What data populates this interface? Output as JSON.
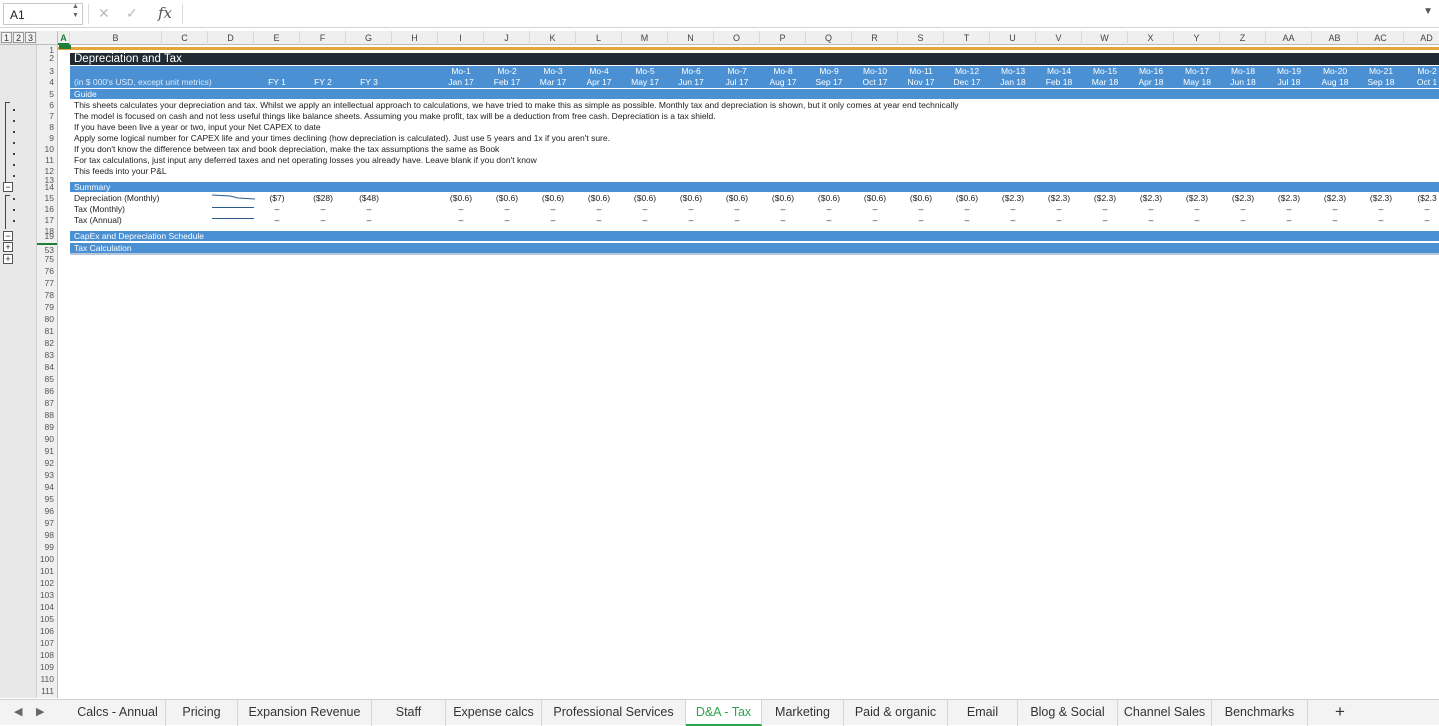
{
  "formula_bar": {
    "name_box": "A1",
    "fx": "fx",
    "formula": ""
  },
  "outline_levels": [
    "1",
    "2",
    "3"
  ],
  "columns": [
    "A",
    "B",
    "C",
    "D",
    "E",
    "F",
    "G",
    "H",
    "I",
    "J",
    "K",
    "L",
    "M",
    "N",
    "O",
    "P",
    "Q",
    "R",
    "S",
    "T",
    "U",
    "V",
    "W",
    "X",
    "Y",
    "Z",
    "AA",
    "AB",
    "AC",
    "AD"
  ],
  "rows": {
    "top": [
      "1",
      "2",
      "3",
      "4",
      "5",
      "6",
      "7",
      "8",
      "9",
      "10",
      "11",
      "12",
      "13",
      "14",
      "15",
      "16",
      "17",
      "18",
      "19",
      "53"
    ],
    "bottom": [
      "75",
      "76",
      "77",
      "78",
      "79",
      "80",
      "81",
      "82",
      "83",
      "84",
      "85",
      "86",
      "87",
      "88",
      "89",
      "90",
      "91",
      "92",
      "93",
      "94",
      "95",
      "96",
      "97",
      "98",
      "99",
      "100",
      "101",
      "102",
      "103",
      "104",
      "105",
      "106",
      "107",
      "108",
      "109",
      "110",
      "111"
    ]
  },
  "sheet": {
    "title": "Depreciation and Tax",
    "units_label": "(in $ 000's USD, except unit metrics)",
    "fy_labels": [
      "FY 1",
      "FY 2",
      "FY 3"
    ],
    "months": [
      "Mo-1",
      "Mo-2",
      "Mo-3",
      "Mo-4",
      "Mo-5",
      "Mo-6",
      "Mo-7",
      "Mo-8",
      "Mo-9",
      "Mo-10",
      "Mo-11",
      "Mo-12",
      "Mo-13",
      "Mo-14",
      "Mo-15",
      "Mo-16",
      "Mo-17",
      "Mo-18",
      "Mo-19",
      "Mo-20",
      "Mo-21",
      "Mo-2"
    ],
    "dates": [
      "Jan 17",
      "Feb 17",
      "Mar 17",
      "Apr 17",
      "May 17",
      "Jun 17",
      "Jul 17",
      "Aug 17",
      "Sep 17",
      "Oct 17",
      "Nov 17",
      "Dec 17",
      "Jan 18",
      "Feb 18",
      "Mar 18",
      "Apr 18",
      "May 18",
      "Jun 18",
      "Jul 18",
      "Aug 18",
      "Sep 18",
      "Oct 1"
    ],
    "guide_header": "Guide",
    "guide_lines": [
      "This sheets calculates your depreciation and tax. Whilst we apply an intellectual approach to calculations, we have tried to make this as simple as possible. Monthly tax and depreciation is shown, but it only comes at year end technically",
      "The model is focused on cash and not less useful things like balance sheets. Assuming you make profit, tax will be a deduction from free cash. Depreciation is a tax shield.",
      "If you have been live a year or two, input your Net CAPEX to date",
      "Apply some logical number for CAPEX life and your times declining (how depreciation is calculated). Just use 5 years and 1x if you aren't sure.",
      "If you don't know the difference between tax and book depreciation, make the tax assumptions the same as Book",
      "For tax calculations, just input any deferred taxes and net operating losses you already have. Leave blank if you don't know",
      "This feeds into your P&L"
    ],
    "summary_header": "Summary",
    "summary_rows": [
      {
        "label": "Depreciation (Monthly)",
        "fy": [
          "($7)",
          "($28)",
          "($48)"
        ],
        "monthly": [
          "($0.6)",
          "($0.6)",
          "($0.6)",
          "($0.6)",
          "($0.6)",
          "($0.6)",
          "($0.6)",
          "($0.6)",
          "($0.6)",
          "($0.6)",
          "($0.6)",
          "($0.6)",
          "($2.3)",
          "($2.3)",
          "($2.3)",
          "($2.3)",
          "($2.3)",
          "($2.3)",
          "($2.3)",
          "($2.3)",
          "($2.3)",
          "($2.3"
        ]
      },
      {
        "label": "Tax (Monthly)",
        "fy": [
          "–",
          "–",
          "–"
        ],
        "monthly": [
          "–",
          "–",
          "–",
          "–",
          "–",
          "–",
          "–",
          "–",
          "–",
          "–",
          "–",
          "–",
          "–",
          "–",
          "–",
          "–",
          "–",
          "–",
          "–",
          "–",
          "–",
          "–"
        ]
      },
      {
        "label": "Tax (Annual)",
        "fy": [
          "–",
          "–",
          "–"
        ],
        "monthly": [
          "–",
          "–",
          "–",
          "–",
          "–",
          "–",
          "–",
          "–",
          "–",
          "–",
          "–",
          "–",
          "–",
          "–",
          "–",
          "–",
          "–",
          "–",
          "–",
          "–",
          "–",
          "–"
        ]
      }
    ],
    "capex_header": "CapEx and Depreciation Schedule",
    "tax_header": "Tax Calculation"
  },
  "tabs": [
    {
      "label": "Calcs - Annual"
    },
    {
      "label": "Pricing"
    },
    {
      "label": "Expansion Revenue"
    },
    {
      "label": "Staff"
    },
    {
      "label": "Expense calcs"
    },
    {
      "label": "Professional Services"
    },
    {
      "label": "D&A - Tax",
      "active": true
    },
    {
      "label": "Marketing"
    },
    {
      "label": "Paid & organic"
    },
    {
      "label": "Email"
    },
    {
      "label": "Blog & Social"
    },
    {
      "label": "Channel Sales"
    },
    {
      "label": "Benchmarks"
    }
  ],
  "add_sheet": "+",
  "colors": {
    "header_dark": "#1f2a33",
    "band_blue": "#4a90d2",
    "accent_orange": "#e8a33a",
    "active_tab": "#2ea44f"
  }
}
